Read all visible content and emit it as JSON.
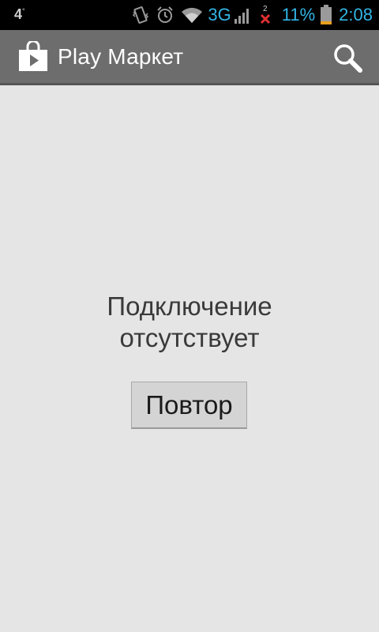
{
  "status_bar": {
    "left_text": "4",
    "left_sup": "°",
    "icons": [
      "vibrate-icon",
      "alarm-icon",
      "wifi-icon",
      "signal-icon",
      "no-data-icon",
      "battery-icon"
    ],
    "network_type": "3G",
    "sim_badge": "2",
    "battery_level": "11%",
    "time": "2:08",
    "accent_color": "#33b5e5"
  },
  "action_bar": {
    "title": "Play Маркет",
    "logo_icon": "play-store-icon",
    "search_icon": "search-icon",
    "background_color": "#6d6d6d"
  },
  "main": {
    "error_line1": "Подключение",
    "error_line2": "отсутствует",
    "retry_label": "Повтор"
  }
}
